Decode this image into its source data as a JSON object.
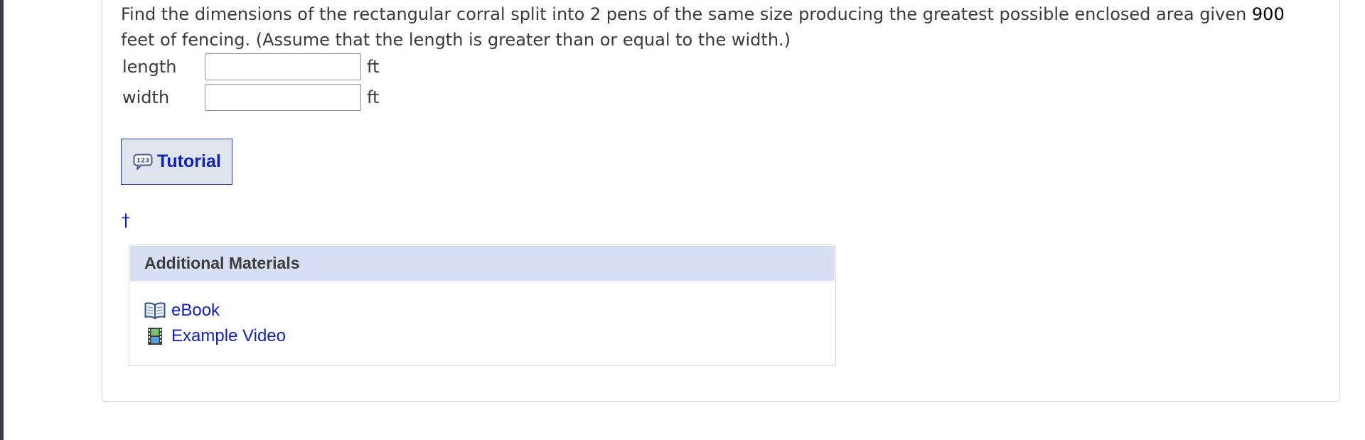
{
  "question": {
    "text_before_number": "Find the dimensions of the rectangular corral split into 2 pens of the same size producing the greatest possible enclosed area given ",
    "fencing_amount": "900",
    "text_after_number": " feet of fencing. (Assume that the length is greater than or equal to the width.)"
  },
  "answers": [
    {
      "label": "length",
      "value": "",
      "unit": "ft"
    },
    {
      "label": "width",
      "value": "",
      "unit": "ft"
    }
  ],
  "tutorial": {
    "label": "Tutorial",
    "icon": "speech-bubble-123-icon"
  },
  "footnote_marker": "†",
  "additional_materials": {
    "title": "Additional Materials",
    "items": [
      {
        "label": "eBook",
        "icon": "book-icon"
      },
      {
        "label": "Example Video",
        "icon": "film-strip-icon"
      }
    ]
  },
  "colors": {
    "link": "#1020b8",
    "materials_header_bg": "#d7dff5",
    "tutorial_bg": "#dfe5ee",
    "tutorial_border": "#2d3fa8"
  }
}
